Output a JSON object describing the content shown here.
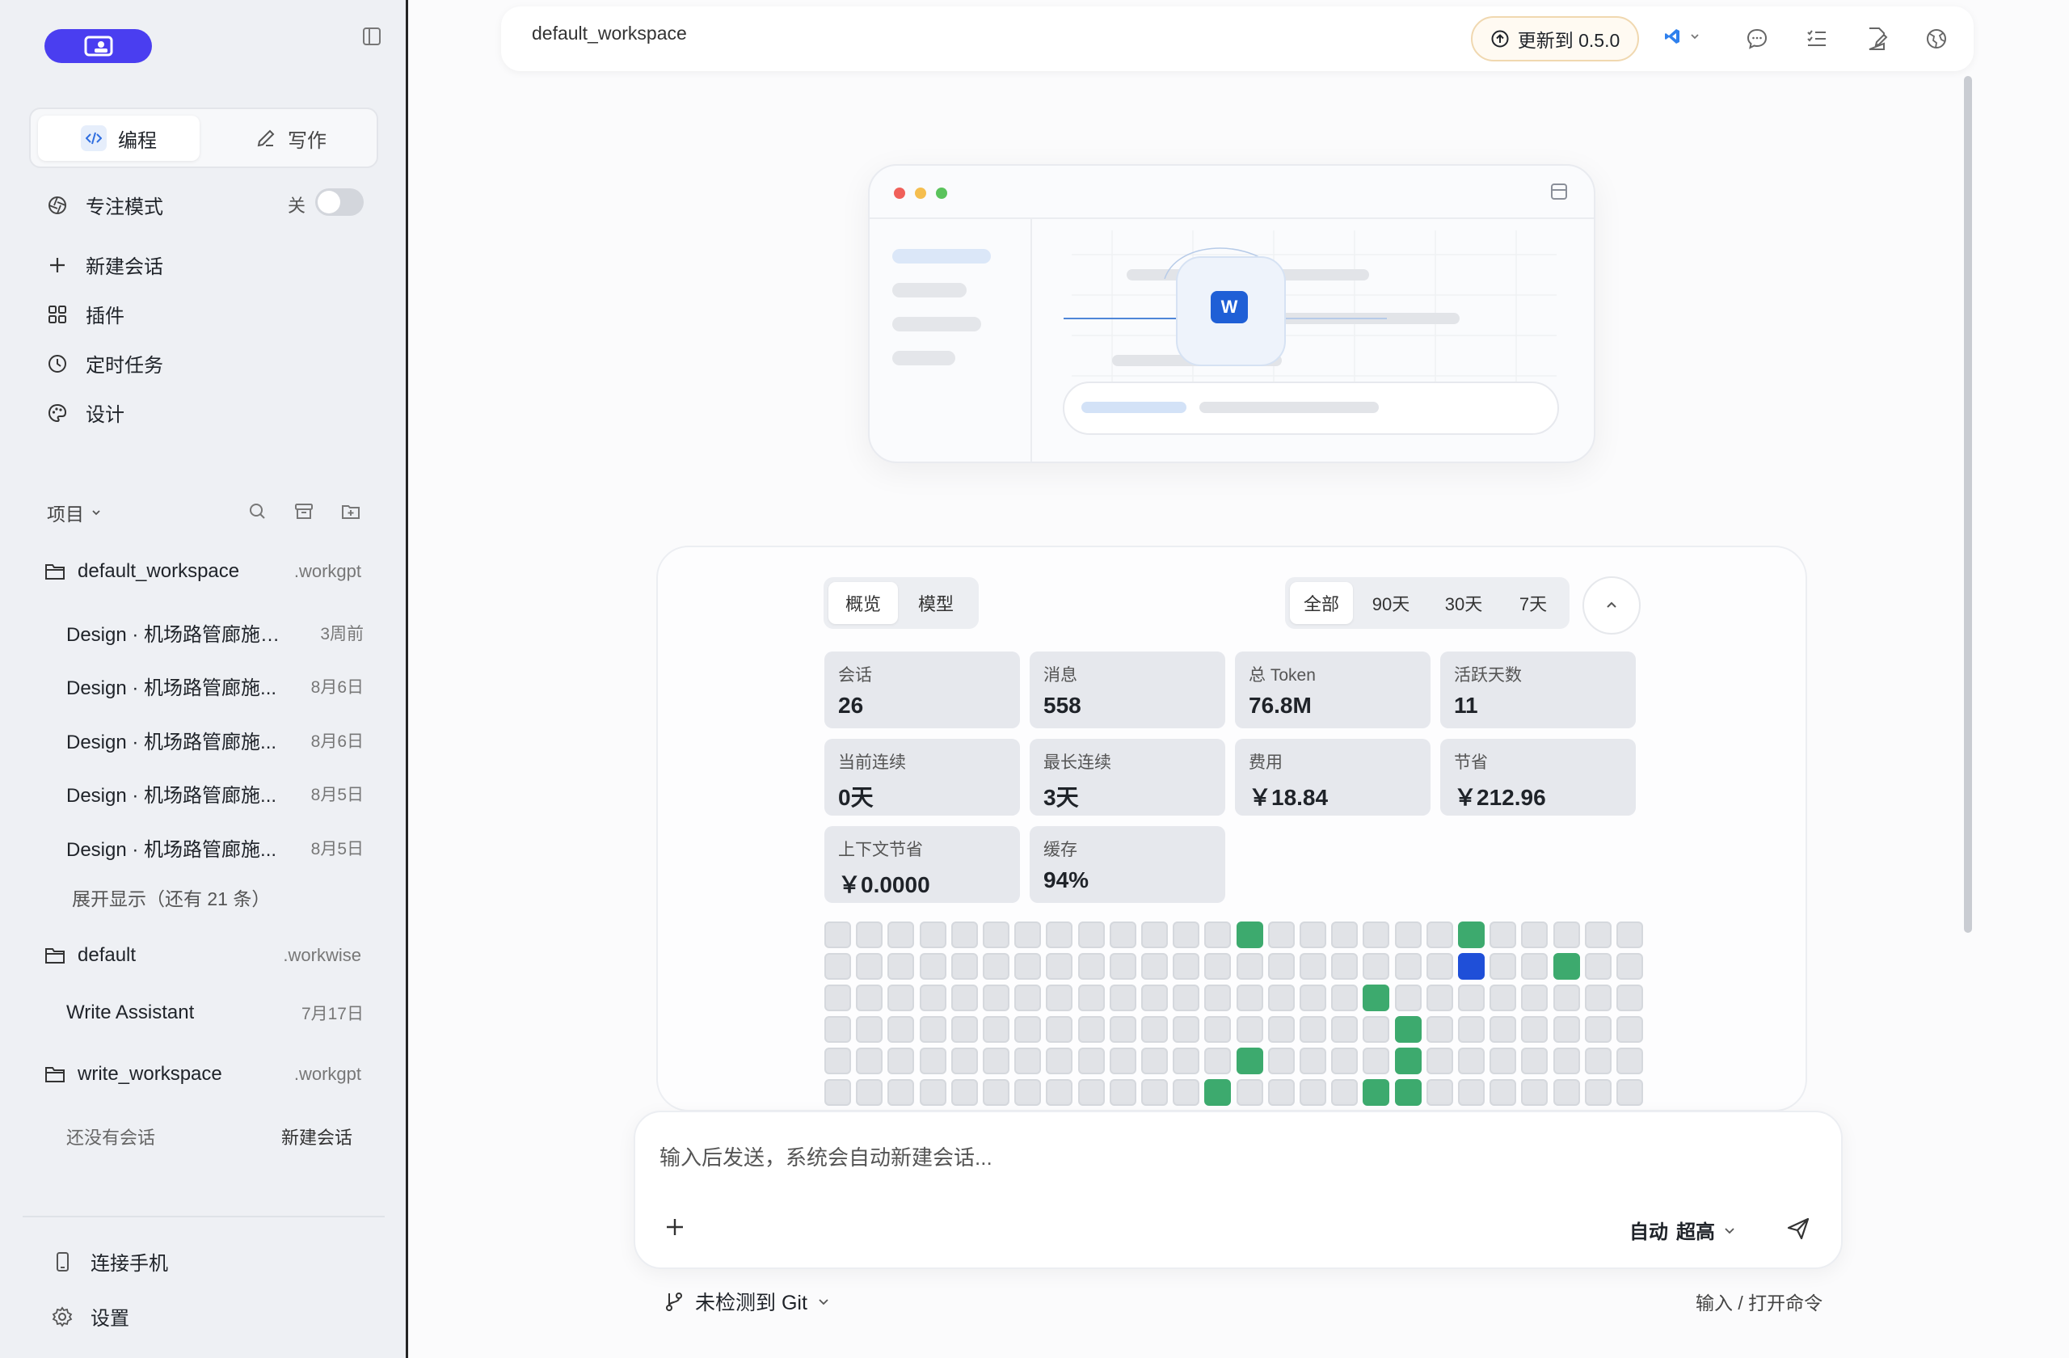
{
  "sidebar": {
    "modes": {
      "code": "编程",
      "write": "写作"
    },
    "focus": {
      "label": "专注模式",
      "state": "关"
    },
    "menu": [
      {
        "label": "新建会话",
        "icon": "plus-icon"
      },
      {
        "label": "插件",
        "icon": "grid-icon"
      },
      {
        "label": "定时任务",
        "icon": "clock-icon"
      },
      {
        "label": "设计",
        "icon": "palette-icon"
      }
    ],
    "projects_label": "项目",
    "workspaces": [
      {
        "name": "default_workspace",
        "ext": ".workgpt",
        "sessions": [
          {
            "title": "Design · 机场路管廊施工...",
            "date": "3周前"
          },
          {
            "title": "Design · 机场路管廊施...",
            "date": "8月6日"
          },
          {
            "title": "Design · 机场路管廊施...",
            "date": "8月6日"
          },
          {
            "title": "Design · 机场路管廊施...",
            "date": "8月5日"
          },
          {
            "title": "Design · 机场路管廊施...",
            "date": "8月5日"
          }
        ],
        "expand": "展开显示（还有 21 条）"
      },
      {
        "name": "default",
        "ext": ".workwise",
        "sessions": [
          {
            "title": "Write Assistant",
            "date": "7月17日"
          }
        ]
      },
      {
        "name": "write_workspace",
        "ext": ".workgpt",
        "empty": "还没有会话",
        "new_session": "新建会话"
      }
    ],
    "bottom": {
      "phone": "连接手机",
      "settings": "设置"
    }
  },
  "header": {
    "workspace": "default_workspace",
    "update": "更新到 0.5.0"
  },
  "stats": {
    "tabs": [
      "概览",
      "模型"
    ],
    "ranges": [
      "全部",
      "90天",
      "30天",
      "7天"
    ],
    "cards": [
      {
        "label": "会话",
        "value": "26"
      },
      {
        "label": "消息",
        "value": "558"
      },
      {
        "label": "总 Token",
        "value": "76.8M"
      },
      {
        "label": "活跃天数",
        "value": "11"
      },
      {
        "label": "当前连续",
        "value": "0天"
      },
      {
        "label": "最长连续",
        "value": "3天"
      },
      {
        "label": "费用",
        "value": "￥18.84"
      },
      {
        "label": "节省",
        "value": "￥212.96"
      },
      {
        "label": "上下文节省",
        "value": "￥0.0000"
      },
      {
        "label": "缓存",
        "value": "94%"
      }
    ],
    "heatmap": {
      "rows": 6,
      "cols": 26,
      "active": [
        [
          0,
          13
        ],
        [
          0,
          20
        ],
        [
          1,
          20,
          "blue"
        ],
        [
          1,
          23
        ],
        [
          2,
          17
        ],
        [
          3,
          18
        ],
        [
          4,
          13
        ],
        [
          4,
          18
        ],
        [
          5,
          12
        ],
        [
          5,
          17
        ],
        [
          5,
          18
        ]
      ],
      "colors": {
        "active": "#3daa6e",
        "highlight": "#1f4fd8",
        "empty": "#e1e3e7"
      }
    }
  },
  "composer": {
    "placeholder": "输入后发送，系统会自动新建会话...",
    "mode": "自动",
    "level": "超高",
    "git": "未检测到 Git",
    "cmd_hint": "输入 / 打开命令"
  }
}
